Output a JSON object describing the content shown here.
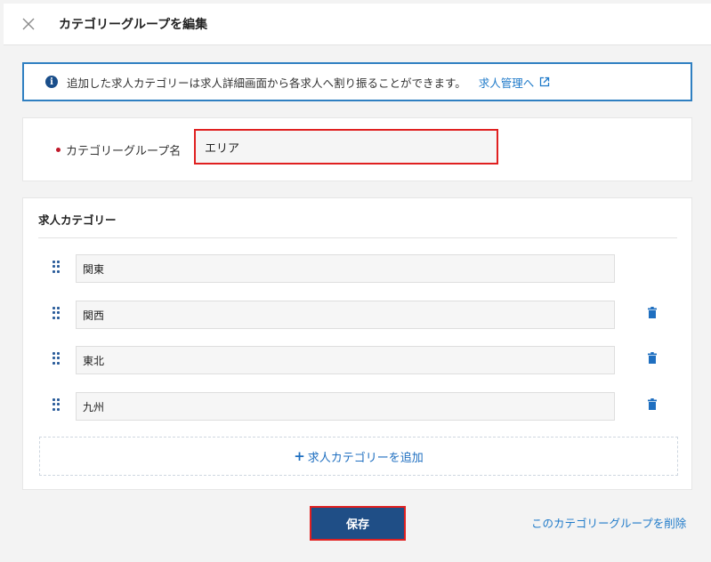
{
  "header": {
    "title": "カテゴリーグループを編集"
  },
  "notice": {
    "text": "追加した求人カテゴリーは求人詳細画面から各求人へ割り振ることができます。",
    "link_label": "求人管理へ",
    "info_icon": "info-icon",
    "accent_color": "#2f7fc1"
  },
  "group_name": {
    "label": "カテゴリーグループ名",
    "value": "エリア",
    "required_color": "#c0192a"
  },
  "categories": {
    "title": "求人カテゴリー",
    "items": [
      {
        "value": "関東"
      },
      {
        "value": "関西"
      },
      {
        "value": "東北"
      },
      {
        "value": "九州"
      }
    ],
    "add_label": "求人カテゴリーを追加"
  },
  "footer": {
    "save_label": "保存",
    "delete_label": "このカテゴリーグループを削除",
    "primary_color": "#1f4e86"
  }
}
